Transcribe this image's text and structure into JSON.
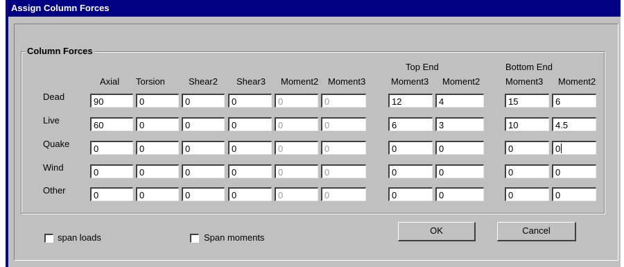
{
  "window": {
    "title": "Assign Column Forces"
  },
  "group": {
    "title": "Column Forces"
  },
  "headers": {
    "top_end": "Top End",
    "bottom_end": "Bottom End",
    "columns": [
      "Axial",
      "Torsion",
      "Shear2",
      "Shear3",
      "Moment2",
      "Moment3",
      "Moment3",
      "Moment2",
      "Moment3",
      "Moment2"
    ]
  },
  "rows": [
    {
      "label": "Dead",
      "values": [
        "90",
        "0",
        "0",
        "0",
        "0",
        "0",
        "12",
        "4",
        "15",
        "6"
      ]
    },
    {
      "label": "Live",
      "values": [
        "60",
        "0",
        "0",
        "0",
        "0",
        "0",
        "6",
        "3",
        "10",
        "4.5"
      ]
    },
    {
      "label": "Quake",
      "values": [
        "0",
        "0",
        "0",
        "0",
        "0",
        "0",
        "0",
        "0",
        "0",
        "0"
      ]
    },
    {
      "label": "Wind",
      "values": [
        "0",
        "0",
        "0",
        "0",
        "0",
        "0",
        "0",
        "0",
        "0",
        "0"
      ]
    },
    {
      "label": "Other",
      "values": [
        "0",
        "0",
        "0",
        "0",
        "0",
        "0",
        "0",
        "0",
        "0",
        "0"
      ]
    }
  ],
  "options": {
    "span_loads": "span loads",
    "span_moments": "Span moments"
  },
  "buttons": {
    "ok": "OK",
    "cancel": "Cancel"
  },
  "colors": {
    "titlebar": "#000080",
    "face": "#c0c0c0",
    "disabled_text": "#9a9a9a"
  }
}
